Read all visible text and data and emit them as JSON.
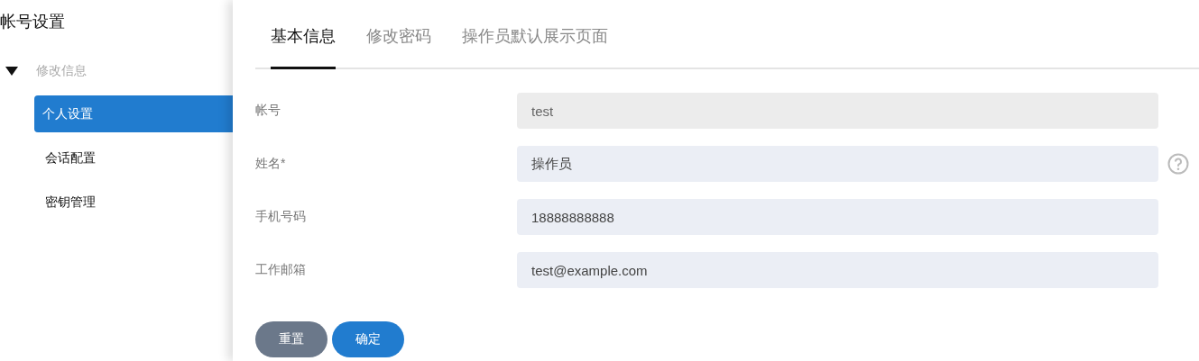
{
  "sidebar": {
    "title": "帐号设置",
    "group": {
      "label": "修改信息",
      "expanded": true,
      "items": [
        {
          "label": "个人设置",
          "selected": true
        },
        {
          "label": "会话配置",
          "selected": false
        },
        {
          "label": "密钥管理",
          "selected": false
        }
      ]
    }
  },
  "tabs": [
    {
      "label": "基本信息",
      "selected": true
    },
    {
      "label": "修改密码",
      "selected": false
    },
    {
      "label": "操作员默认展示页面",
      "selected": false
    }
  ],
  "fields": [
    {
      "label": "帐号",
      "value": "test",
      "disabled": true,
      "help": false
    },
    {
      "label": "姓名*",
      "value": "操作员",
      "disabled": false,
      "help": true
    },
    {
      "label": "手机号码",
      "value": "18888888888",
      "disabled": false,
      "help": false
    },
    {
      "label": "工作邮箱",
      "value": "test@example.com",
      "disabled": false,
      "help": false
    }
  ],
  "buttons": [
    {
      "label": "重置",
      "kind": "secondary"
    },
    {
      "label": "确定",
      "kind": "primary"
    }
  ]
}
